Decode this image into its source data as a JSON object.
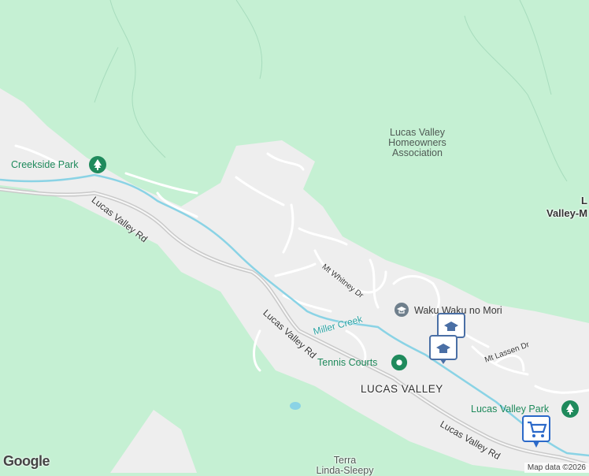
{
  "map": {
    "colors": {
      "land": "#c5f0d3",
      "developed": "#eeeeee",
      "street": "#ffffff",
      "highway": "#c9c9c9",
      "creek": "#8ad3e5",
      "park_pin": "#1f8a5c",
      "school_pin": "#4a6fa5",
      "shop_pin": "#2b69c9"
    },
    "places": {
      "creekside_park": "Creekside Park",
      "hoa": "Lucas Valley Homeowners Association",
      "hoa_l1": "Lucas Valley",
      "hoa_l2": "Homeowners",
      "hoa_l3": "Association",
      "waku": "Waku Waku no Mori",
      "tennis": "Tennis Courts",
      "lucas_valley": "LUCAS VALLEY",
      "lucas_valley_park": "Lucas Valley Park",
      "terra_l1": "Terra",
      "terra_l2": "Linda-Sleepy",
      "edge_l1": "L",
      "edge_l2": "Valley-M"
    },
    "roads": {
      "lucas_valley_rd_1": "Lucas Valley Rd",
      "lucas_valley_rd_2": "Lucas Valley Rd",
      "lucas_valley_rd_3": "Lucas Valley Rd",
      "mt_whitney": "Mt Whitney Dr",
      "mt_lassen": "Mt Lassen Dr",
      "miller_creek": "Miller Creek"
    },
    "icons": [
      "park-icon",
      "school-icon",
      "shopping-cart-icon"
    ],
    "attribution": "Map data ©2026",
    "logo": "Google"
  }
}
